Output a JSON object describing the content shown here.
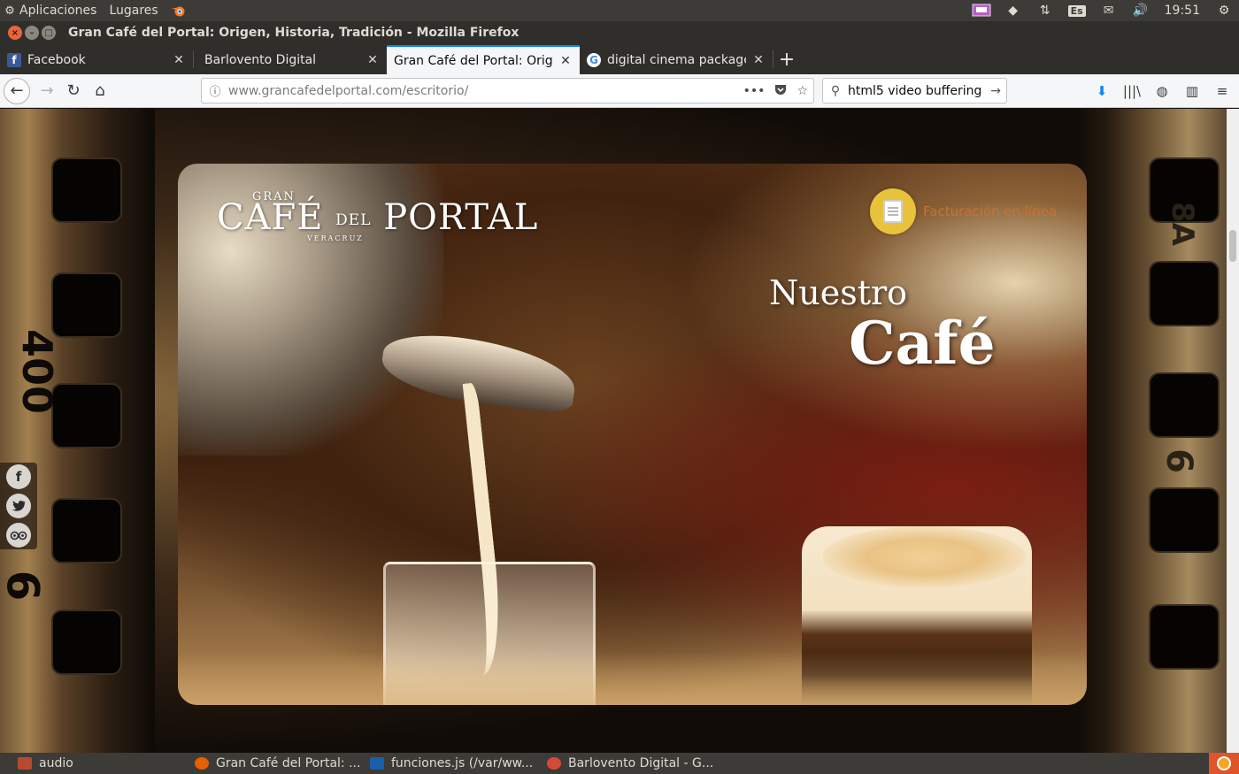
{
  "system_panel": {
    "menus": [
      "Aplicaciones",
      "Lugares"
    ],
    "keyboard_layout": "Es",
    "clock": "19:51"
  },
  "window": {
    "title": "Gran Café del Portal: Origen, Historia, Tradición - Mozilla Firefox"
  },
  "tabs": [
    {
      "label": "Facebook",
      "favicon": "facebook-icon",
      "active": false
    },
    {
      "label": "Barlovento Digital",
      "favicon": "",
      "active": false
    },
    {
      "label": "Gran Café del Portal: Origen",
      "favicon": "",
      "active": true
    },
    {
      "label": "digital cinema package -",
      "favicon": "google-icon",
      "active": false
    }
  ],
  "toolbar": {
    "url_host": "www.grancafedelportal.com",
    "url_path": "/escritorio/",
    "search_query": "html5 video buffering"
  },
  "page": {
    "logo": {
      "gran": "GRAN",
      "main_left": "CAFÉ",
      "main_del": "DEL",
      "main_right": "PORTAL",
      "city": "VERACRUZ"
    },
    "billing_link": "Facturación en línea",
    "heading_line1": "Nuestro",
    "heading_line2": "Café",
    "film_numbers": {
      "left_top": "400",
      "left_bottom": "6",
      "right_top": "8A",
      "right_bottom": "6"
    },
    "social": [
      "facebook-icon",
      "twitter-icon",
      "tripadvisor-icon"
    ]
  },
  "taskbar": {
    "items": [
      "audio",
      "Gran Café del Portal: ...",
      "funciones.js (/var/ww...",
      "Barlovento Digital - G..."
    ]
  },
  "colors": {
    "accent_tab": "#0a84ff",
    "billing_badge": "#e8c23a",
    "billing_text": "#c9722d",
    "panel": "#3c3b37"
  }
}
